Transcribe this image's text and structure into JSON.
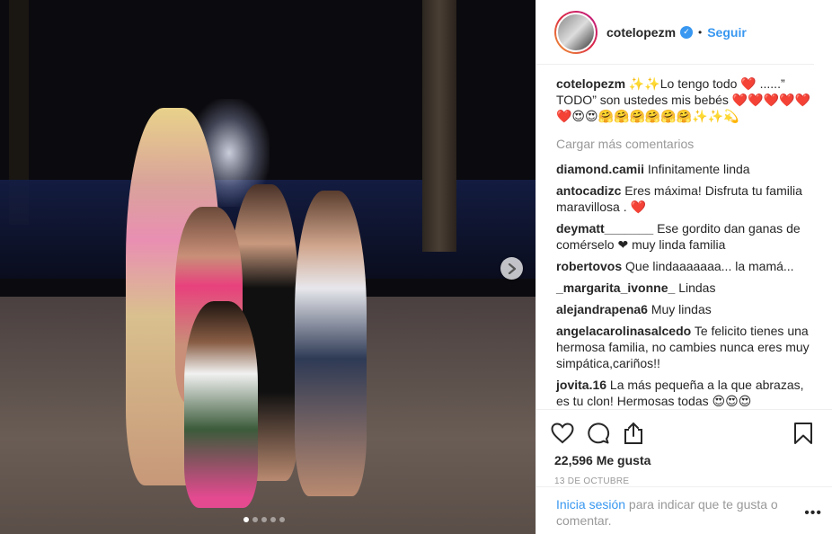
{
  "post": {
    "carousel": {
      "slides": 5,
      "active": 1
    },
    "next_icon": "chevron-right-icon"
  },
  "header": {
    "username": "cotelopezm",
    "verified_icon": "verified-badge-icon",
    "separator": "•",
    "follow_label": "Seguir"
  },
  "caption": {
    "user": "cotelopezm",
    "text": "✨✨Lo tengo todo ❤️ ......” TODO” son ustedes mis bebés ❤️❤️❤️❤️❤️❤️😍😍🤗🤗🤗🤗🤗🤗✨✨💫"
  },
  "load_more_label": "Cargar más comentarios",
  "comments": [
    {
      "user": "diamond.camii",
      "text": "Infinitamente linda"
    },
    {
      "user": "antocadizc",
      "text": "Eres máxima! Disfruta tu familia maravillosa . ❤️"
    },
    {
      "user": "deymatt_______",
      "text": "Ese gordito dan ganas de comérselo ❤ muy linda familia"
    },
    {
      "user": "robertovos",
      "text": "Que lindaaaaaaa... la mamá..."
    },
    {
      "user": "_margarita_ivonne_",
      "text": "Lindas"
    },
    {
      "user": "alejandrapena6",
      "text": "Muy lindas"
    },
    {
      "user": "angelacarolinasalcedo",
      "text": "Te felicito tienes una hermosa familia, no cambies nunca eres muy simpática,cariños!!"
    },
    {
      "user": "jovita.16",
      "text": "La más pequeña a la que abrazas, es tu clon! Hermosas todas 😍😍😍"
    }
  ],
  "actions": {
    "like_icon": "heart-icon",
    "comment_icon": "comment-bubble-icon",
    "share_icon": "share-icon",
    "save_icon": "bookmark-icon"
  },
  "likes_text": "22,596 Me gusta",
  "date_text": "13 DE OCTUBRE",
  "footer": {
    "login_label": "Inicia sesión",
    "rest_text": " para indicar que te gusta o comentar.",
    "more_label": "•••"
  }
}
